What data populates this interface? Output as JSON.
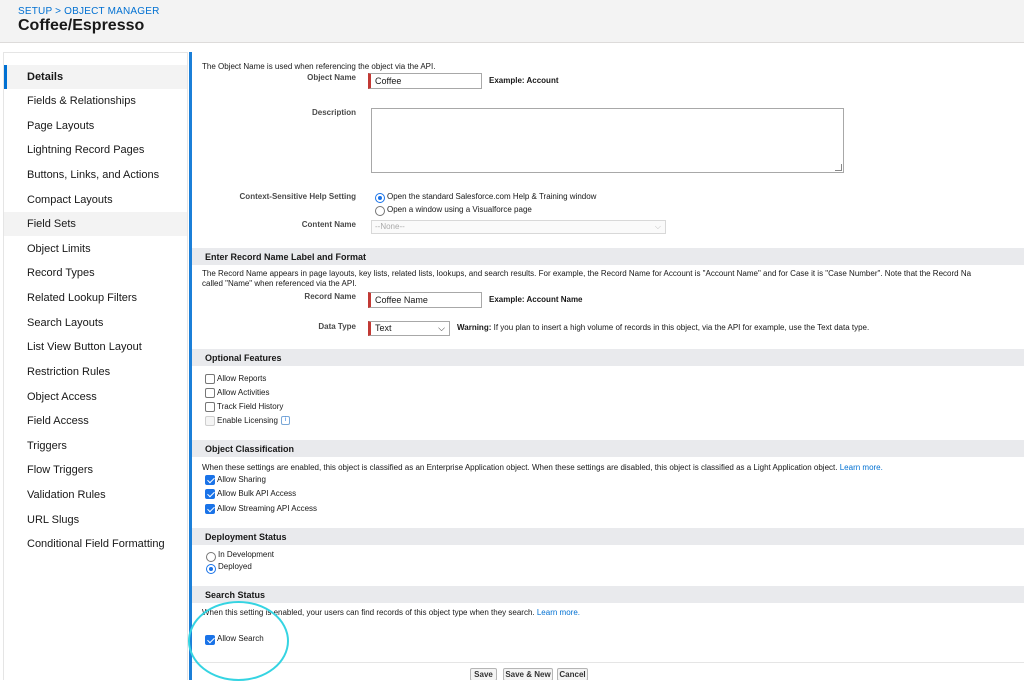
{
  "header": {
    "breadcrumb": "SETUP > OBJECT MANAGER",
    "title": "Coffee/Espresso"
  },
  "sidebar": {
    "items": [
      {
        "label": "Details"
      },
      {
        "label": "Fields & Relationships"
      },
      {
        "label": "Page Layouts"
      },
      {
        "label": "Lightning Record Pages"
      },
      {
        "label": "Buttons, Links, and Actions"
      },
      {
        "label": "Compact Layouts"
      },
      {
        "label": "Field Sets"
      },
      {
        "label": "Object Limits"
      },
      {
        "label": "Record Types"
      },
      {
        "label": "Related Lookup Filters"
      },
      {
        "label": "Search Layouts"
      },
      {
        "label": "List View Button Layout"
      },
      {
        "label": "Restriction Rules"
      },
      {
        "label": "Object Access"
      },
      {
        "label": "Field Access"
      },
      {
        "label": "Triggers"
      },
      {
        "label": "Flow Triggers"
      },
      {
        "label": "Validation Rules"
      },
      {
        "label": "URL Slugs"
      },
      {
        "label": "Conditional Field Formatting"
      }
    ]
  },
  "details": {
    "intro": "The Object Name is used when referencing the object via the API.",
    "object_name_label": "Object Name",
    "object_name_value": "Coffee",
    "object_name_example": "Example:  Account",
    "description_label": "Description",
    "help_label": "Context-Sensitive Help Setting",
    "help_opt1": "Open the standard Salesforce.com Help & Training window",
    "help_opt2": "Open a window using a Visualforce page",
    "content_name_label": "Content Name",
    "content_name_value": "--None--"
  },
  "record_name": {
    "title": "Enter Record Name Label and Format",
    "desc1": "The Record Name appears in page layouts, key lists, related lists, lookups, and search results. For example, the Record Name for Account is \"Account Name\" and for Case it is \"Case Number\". Note that the Record Na",
    "desc2": "called \"Name\" when referenced via the API.",
    "label": "Record Name",
    "value": "Coffee Name",
    "example": "Example:  Account Name",
    "data_type_label": "Data Type",
    "data_type_value": "Text",
    "warning_bold": "Warning:",
    "warning_text": " If you plan to insert a high volume of records in this object, via the API for example, use the Text data type."
  },
  "optional": {
    "title": "Optional Features",
    "items": [
      {
        "label": "Allow Reports"
      },
      {
        "label": "Allow Activities"
      },
      {
        "label": "Track Field History"
      },
      {
        "label": "Enable Licensing"
      }
    ]
  },
  "classification": {
    "title": "Object Classification",
    "desc": "When these settings are enabled, this object is classified as an Enterprise Application object. When these settings are disabled, this object is classified as a Light Application object.",
    "learn_more": "Learn more.",
    "items": [
      {
        "label": "Allow Sharing"
      },
      {
        "label": "Allow Bulk API Access"
      },
      {
        "label": "Allow Streaming API Access"
      }
    ]
  },
  "deployment": {
    "title": "Deployment Status",
    "opt1": "In Development",
    "opt2": "Deployed"
  },
  "search": {
    "title": "Search Status",
    "desc": "When this setting is enabled, your users can find records of this object type when they search.",
    "learn_more": "Learn more.",
    "allow_label": "Allow Search"
  },
  "footer": {
    "save": "Save",
    "save_new": "Save & New",
    "cancel": "Cancel"
  },
  "colors": {
    "accent": "#0070d2",
    "required": "#c23934",
    "annotation": "#35d4e2"
  }
}
